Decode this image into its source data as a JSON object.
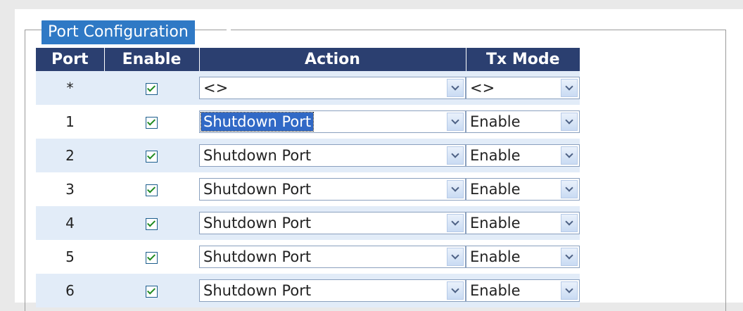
{
  "legend": "Port Configuration",
  "headers": {
    "port": "Port",
    "enable": "Enable",
    "action": "Action",
    "tx_mode": "Tx Mode"
  },
  "rows": [
    {
      "port": "*",
      "enabled": true,
      "action": "<>",
      "tx_mode": "<>"
    },
    {
      "port": "1",
      "enabled": true,
      "action": "Shutdown Port",
      "tx_mode": "Enable",
      "action_focused": true
    },
    {
      "port": "2",
      "enabled": true,
      "action": "Shutdown Port",
      "tx_mode": "Enable"
    },
    {
      "port": "3",
      "enabled": true,
      "action": "Shutdown Port",
      "tx_mode": "Enable"
    },
    {
      "port": "4",
      "enabled": true,
      "action": "Shutdown Port",
      "tx_mode": "Enable"
    },
    {
      "port": "5",
      "enabled": true,
      "action": "Shutdown Port",
      "tx_mode": "Enable"
    },
    {
      "port": "6",
      "enabled": true,
      "action": "Shutdown Port",
      "tx_mode": "Enable"
    }
  ],
  "colors": {
    "header_bg": "#2b3f70",
    "legend_bg": "#2f79c5",
    "row_alt": "#e2ecf8"
  }
}
